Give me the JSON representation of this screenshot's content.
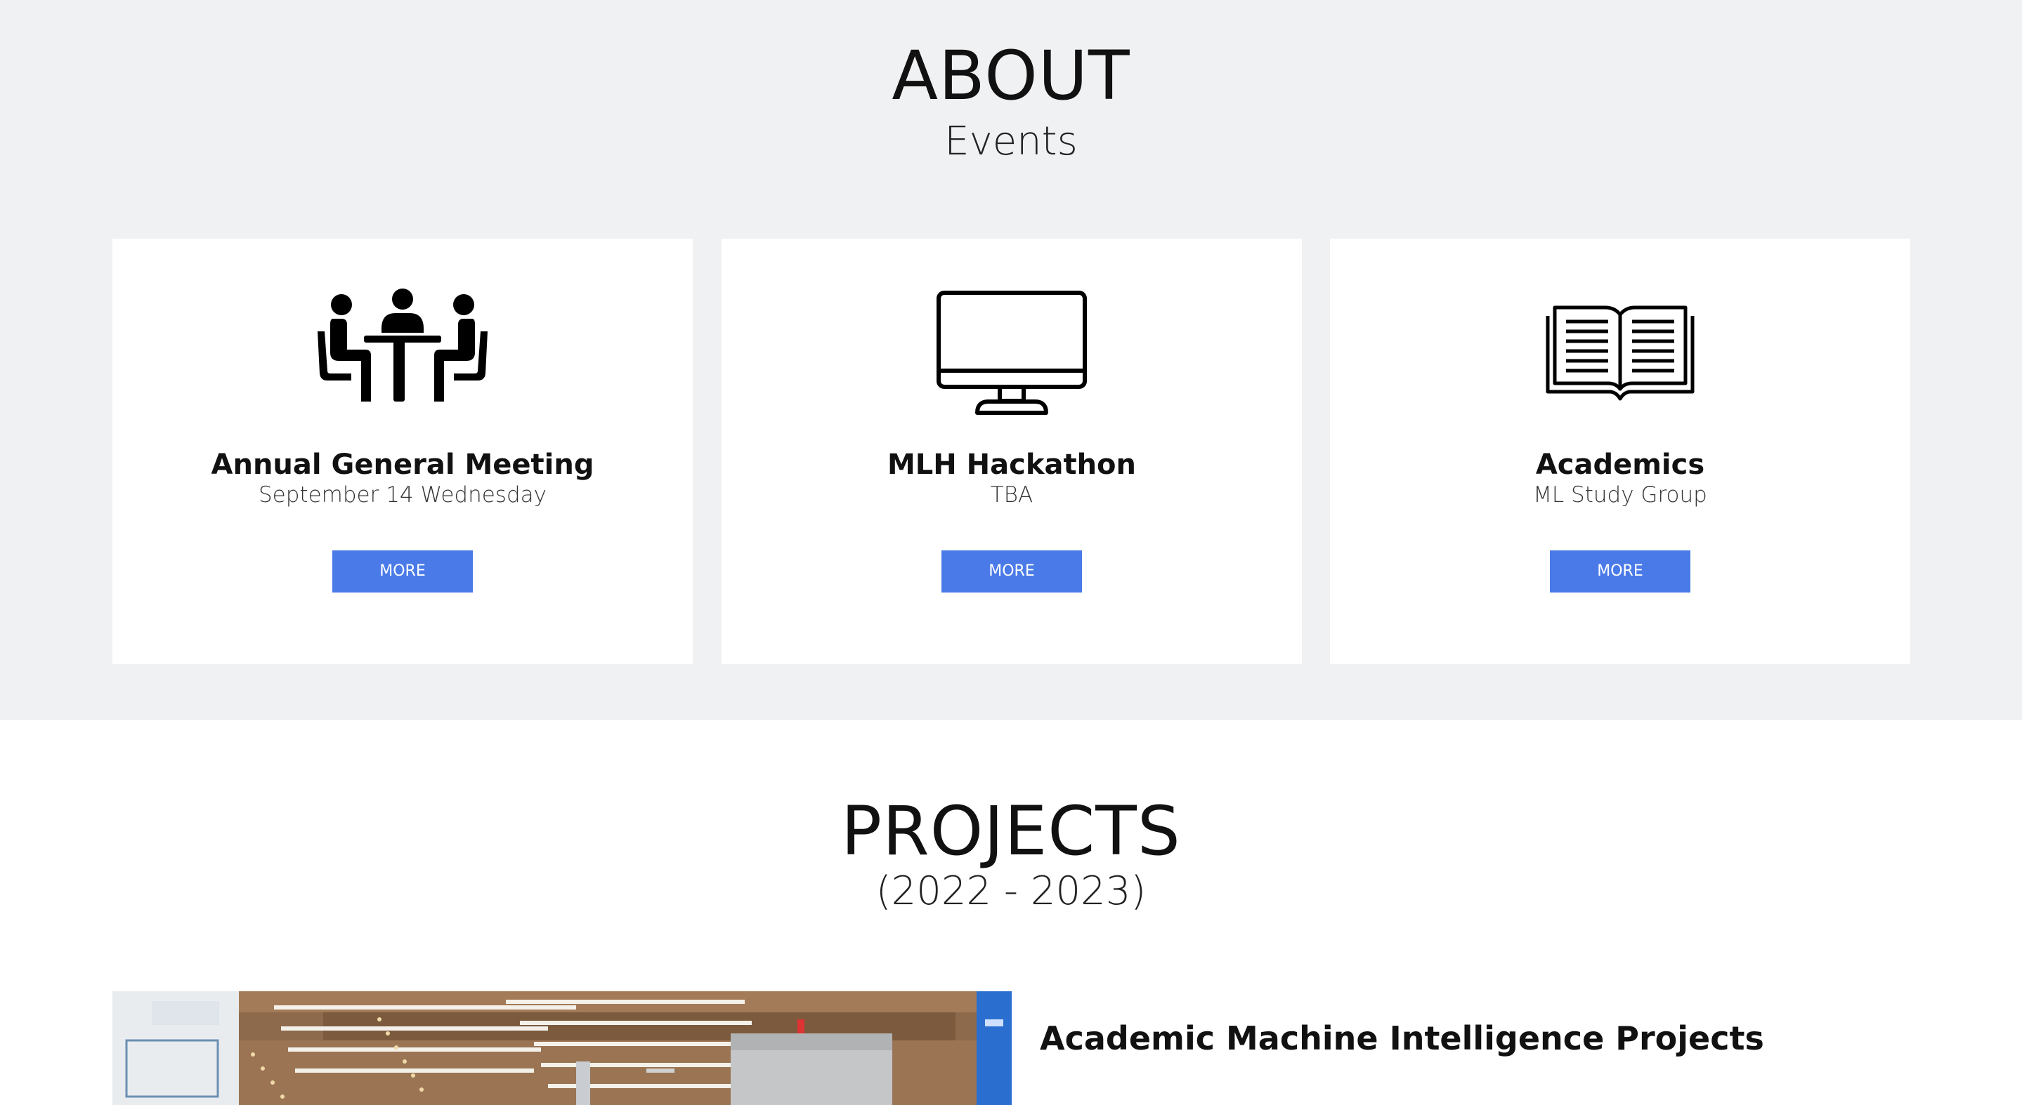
{
  "about": {
    "title": "ABOUT",
    "subtitle": "Events",
    "cards": [
      {
        "icon": "meeting-table-icon",
        "title": "Annual General Meeting",
        "subtitle": "September 14 Wednesday",
        "button_label": "MORE"
      },
      {
        "icon": "monitor-icon",
        "title": "MLH Hackathon",
        "subtitle": "TBA",
        "button_label": "MORE"
      },
      {
        "icon": "open-book-icon",
        "title": "Academics",
        "subtitle": "ML Study Group",
        "button_label": "MORE"
      }
    ]
  },
  "projects": {
    "title": "PROJECTS",
    "subtitle": "(2022 - 2023)",
    "items": [
      {
        "title": "Academic Machine Intelligence Projects"
      }
    ]
  },
  "colors": {
    "about_background": "#f0f1f3",
    "card_background": "#ffffff",
    "button_blue": "#4a7ae8"
  }
}
